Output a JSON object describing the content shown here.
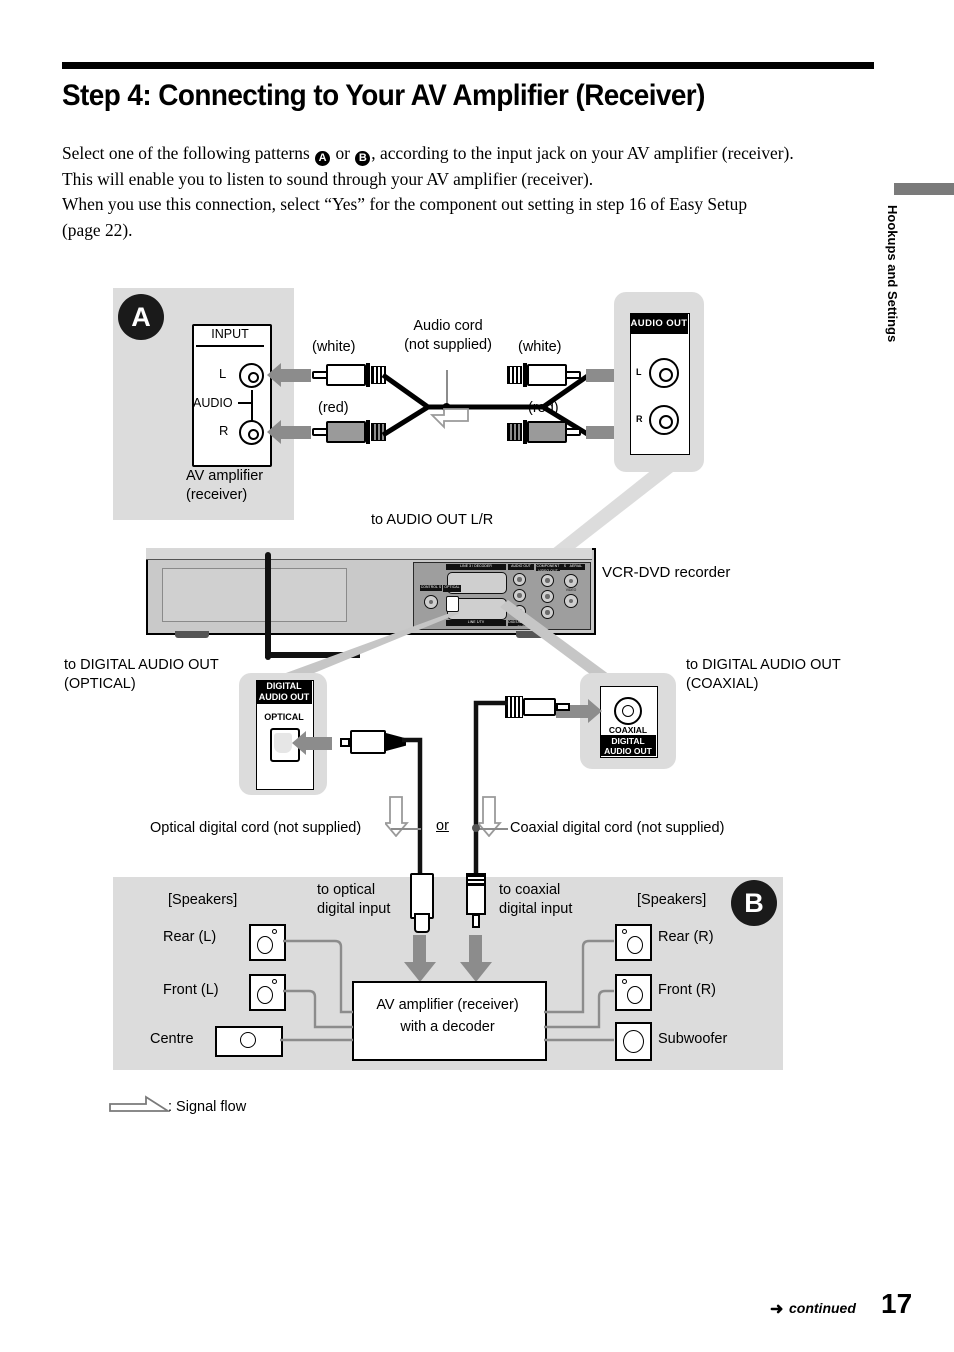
{
  "page": {
    "title": "Step 4: Connecting to Your AV Amplifier (Receiver)",
    "number": "17",
    "continued_label": "continued",
    "continued_arrow": "➜",
    "side_tab": "Hookups and Settings"
  },
  "intro": {
    "line1_a": "Select one of the following patterns ",
    "badge_a": "A",
    "line1_b": " or ",
    "badge_b": "B",
    "line1_c": ", according to the input jack on your AV amplifier (receiver).",
    "line2": "This will enable you to listen to sound through your AV amplifier (receiver).",
    "line3": "When you use this connection, select “Yes” for the component out setting in step 16 of Easy Setup",
    "line4": "(page 22)."
  },
  "pattern_a": {
    "badge": "A",
    "amplifier": {
      "input_header": "INPUT",
      "jack_l": "L",
      "jack_r": "R",
      "audio_label": "AUDIO",
      "caption_line1": "AV amplifier",
      "caption_line2": "(receiver)"
    },
    "cord": {
      "name_line1": "Audio cord",
      "name_line2": "(not supplied)",
      "white_left": "(white)",
      "red_left": "(red)",
      "white_right": "(white)",
      "red_right": "(red)"
    },
    "audio_out_callout": {
      "header": "AUDIO OUT",
      "jack_l": "L",
      "jack_r": "R"
    },
    "to_label": "to AUDIO OUT L/R"
  },
  "recorder": {
    "caption": "VCR-DVD recorder",
    "rear_panel_labels": {
      "line_scart_top": "LINE 3 / DECODER",
      "line_scart_bottom": "LINE 1/TV",
      "audio_out": "AUDIO OUT",
      "component": "COMPONENT VIDEO OUT",
      "s_video": "S VIDEO OUT",
      "aerial": "AERIAL",
      "aerial_in": "IN",
      "aerial_out": "OUT",
      "video": "VIDEO",
      "control_s": "CONTROL S",
      "digital_audio_out": "DIGITAL AUDIO OUT",
      "optical": "OPTICAL",
      "coaxial": "COAXIAL",
      "left": "L",
      "right": "R"
    }
  },
  "optical": {
    "to_label_line1": "to DIGITAL AUDIO OUT",
    "to_label_line2": "(OPTICAL)",
    "panel_header_line1": "DIGITAL",
    "panel_header_line2": "AUDIO OUT",
    "panel_sub": "OPTICAL",
    "cord_label": "Optical digital cord (not supplied)"
  },
  "coaxial": {
    "to_label_line1": "to DIGITAL AUDIO OUT",
    "to_label_line2": "(COAXIAL)",
    "panel_sub": "COAXIAL",
    "panel_header_line1": "DIGITAL",
    "panel_header_line2": "AUDIO OUT",
    "cord_label": "Coaxial digital cord (not supplied)"
  },
  "or_label": "or",
  "pattern_b": {
    "badge": "B",
    "speakers_left_header": "[Speakers]",
    "speakers_right_header": "[Speakers]",
    "to_optical_line1": "to optical",
    "to_optical_line2": "digital input",
    "to_coaxial_line1": "to coaxial",
    "to_coaxial_line2": "digital input",
    "decoder_line1": "AV amplifier (receiver)",
    "decoder_line2": "with a decoder",
    "left_speakers": [
      "Rear (L)",
      "Front (L)",
      "Centre"
    ],
    "right_speakers": [
      "Rear (R)",
      "Front (R)",
      "Subwoofer"
    ]
  },
  "legend": {
    "signal_flow": ": Signal flow"
  },
  "colors": {
    "panel_gray": "#dcdcdc",
    "arrow_gray": "#8c8c8c",
    "wire_gray": "#8c8c8c",
    "black": "#000000",
    "red_plug": "#9a9a9a",
    "white_plug": "#ffffff"
  }
}
